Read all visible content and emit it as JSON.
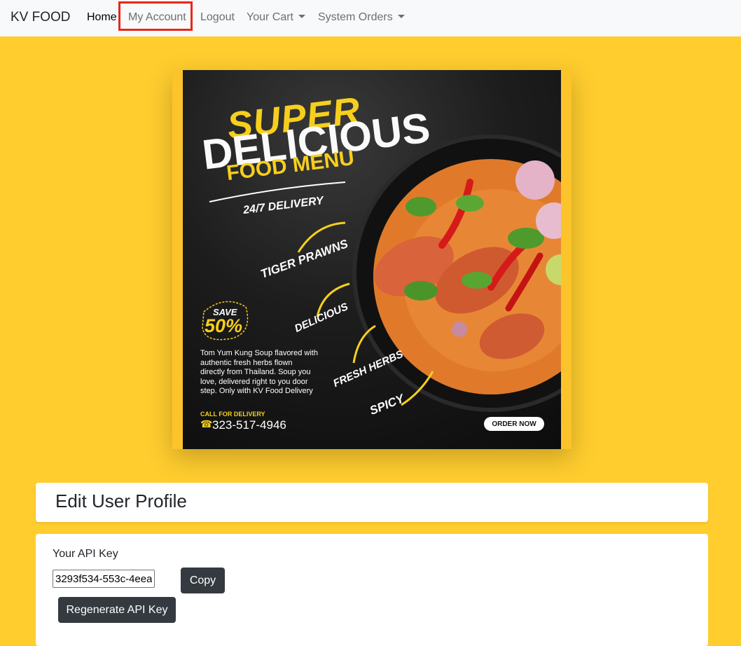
{
  "navbar": {
    "brand": "KV FOOD",
    "items": [
      {
        "label": "Home"
      },
      {
        "label": "My Account"
      },
      {
        "label": "Logout"
      },
      {
        "label": "Your Cart"
      },
      {
        "label": "System Orders"
      }
    ]
  },
  "poster": {
    "headline_1": "SUPER",
    "headline_2": "DELICIOUS",
    "headline_3": "FOOD MENU",
    "delivery": "24/7 DELIVERY",
    "tags": [
      "TIGER PRAWNS",
      "DELICIOUS",
      "FRESH HERBS",
      "SPICY"
    ],
    "save_label": "SAVE",
    "save_percent": "50%",
    "description": "Tom Yum Kung Soup flavored with authentic fresh herbs flown directly from Thailand. Soup you love, delivered right to you door step. Only with KV Food Delivery",
    "call_label": "CALL FOR DELIVERY",
    "phone": "323-517-4946",
    "order_button": "ORDER NOW"
  },
  "profile": {
    "title": "Edit User Profile",
    "api_key_label": "Your API Key",
    "api_key_value": "3293f534-553c-4eea-",
    "copy_button": "Copy",
    "regenerate_button": "Regenerate API Key"
  },
  "colors": {
    "page_background": "#ffcd2e",
    "accent_yellow": "#f6cf1d",
    "button_dark": "#343a40",
    "highlight_box": "#e8271a"
  }
}
